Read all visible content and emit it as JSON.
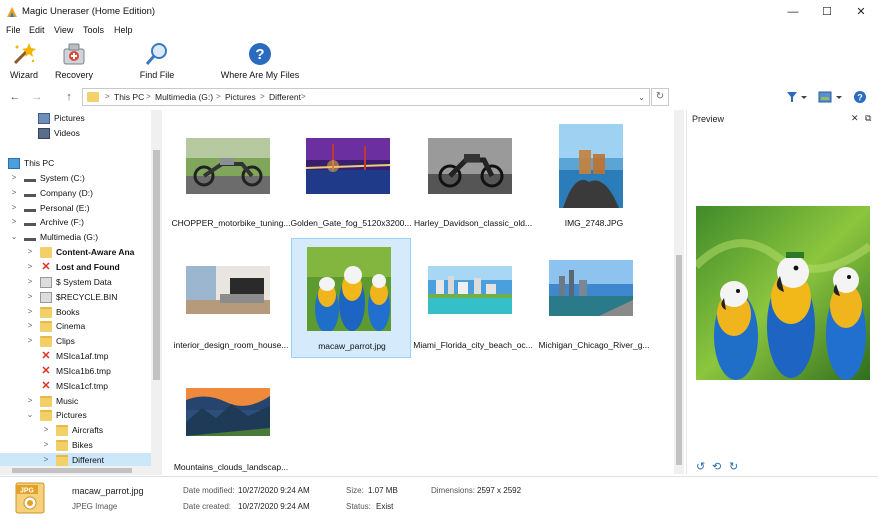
{
  "window": {
    "title": "Magic Uneraser (Home Edition)",
    "minimize": "—",
    "maximize": "☐",
    "close": "✕"
  },
  "menu": [
    "File",
    "Edit",
    "View",
    "Tools",
    "Help"
  ],
  "toolbar": {
    "wizard": "Wizard",
    "recovery": "Recovery",
    "find_file": "Find File",
    "where_files": "Where Are My Files"
  },
  "address": {
    "back": "←",
    "forward": "→",
    "up": "↑",
    "crumbs": [
      "This PC",
      "Multimedia (G:)",
      "Pictures",
      "Different"
    ],
    "separator": ">",
    "dropdown": "⌄",
    "refresh": "↻"
  },
  "tree": [
    {
      "label": "Pictures",
      "icon": "pictures-icon",
      "chev": ""
    },
    {
      "label": "Videos",
      "icon": "videos-icon",
      "chev": ""
    },
    {
      "label": "This PC",
      "icon": "pc-icon",
      "chev": "⌄"
    },
    {
      "label": "System (C:)",
      "icon": "drive-icon",
      "chev": ">"
    },
    {
      "label": "Company (D:)",
      "icon": "drive-icon",
      "chev": ">"
    },
    {
      "label": "Personal (E:)",
      "icon": "drive-icon",
      "chev": ">"
    },
    {
      "label": "Archive (F:)",
      "icon": "drive-icon",
      "chev": ">"
    },
    {
      "label": "Multimedia (G:)",
      "icon": "drive-icon",
      "chev": "⌄"
    },
    {
      "label": "Content-Aware Ana",
      "icon": "search-folder-icon",
      "chev": ">",
      "bold": true
    },
    {
      "label": "Lost and Found",
      "icon": "deleted-icon",
      "chev": ">",
      "bold": true
    },
    {
      "label": "$ System Data",
      "icon": "system-icon",
      "chev": ">"
    },
    {
      "label": "$RECYCLE.BIN",
      "icon": "system-icon",
      "chev": ">"
    },
    {
      "label": "Books",
      "icon": "folder-icon",
      "chev": ">"
    },
    {
      "label": "Cinema",
      "icon": "folder-icon",
      "chev": ">"
    },
    {
      "label": "Clips",
      "icon": "folder-icon",
      "chev": ">"
    },
    {
      "label": "MSIca1af.tmp",
      "icon": "deleted-icon",
      "chev": ""
    },
    {
      "label": "MSIca1b6.tmp",
      "icon": "deleted-icon",
      "chev": ""
    },
    {
      "label": "MSIca1cf.tmp",
      "icon": "deleted-icon",
      "chev": ""
    },
    {
      "label": "Music",
      "icon": "folder-icon",
      "chev": ">"
    },
    {
      "label": "Pictures",
      "icon": "folder-icon",
      "chev": "⌄"
    },
    {
      "label": "Aircrafts",
      "icon": "folder-icon",
      "chev": ">"
    },
    {
      "label": "Bikes",
      "icon": "folder-icon",
      "chev": ">"
    },
    {
      "label": "Different",
      "icon": "folder-icon",
      "chev": ">",
      "selected": true
    }
  ],
  "files": [
    {
      "name": "CHOPPER_motorbike_tuning...",
      "thumb": "chopper"
    },
    {
      "name": "Golden_Gate_fog_5120x3200...",
      "thumb": "bridge"
    },
    {
      "name": "Harley_Davidson_classic_old...",
      "thumb": "harley"
    },
    {
      "name": "IMG_2748.JPG",
      "thumb": "drinks"
    },
    {
      "name": "interior_design_room_house...",
      "thumb": "interior"
    },
    {
      "name": "macaw_parrot.jpg",
      "thumb": "parrot",
      "selected": true
    },
    {
      "name": "Miami_Florida_city_beach_oc...",
      "thumb": "miami"
    },
    {
      "name": "Michigan_Chicago_River_g...",
      "thumb": "chicago"
    },
    {
      "name": "Mountains_clouds_landscap...",
      "thumb": "mountains"
    }
  ],
  "preview": {
    "title": "Preview",
    "close": "✕",
    "undock": "⧉",
    "rotate_left": "↺",
    "flip": "⟲",
    "rotate_right": "↻"
  },
  "status": {
    "file_name": "macaw_parrot.jpg",
    "file_type": "JPEG Image",
    "icon_text": "JPG",
    "date_modified_label": "Date modified:",
    "date_modified": "10/27/2020 9:24 AM",
    "date_created_label": "Date created:",
    "date_created": "10/27/2020 9:24 AM",
    "size_label": "Size:",
    "size": "1.07 MB",
    "status_label": "Status:",
    "status": "Exist",
    "dimensions_label": "Dimensions:",
    "dimensions": "2597 x 2592"
  }
}
